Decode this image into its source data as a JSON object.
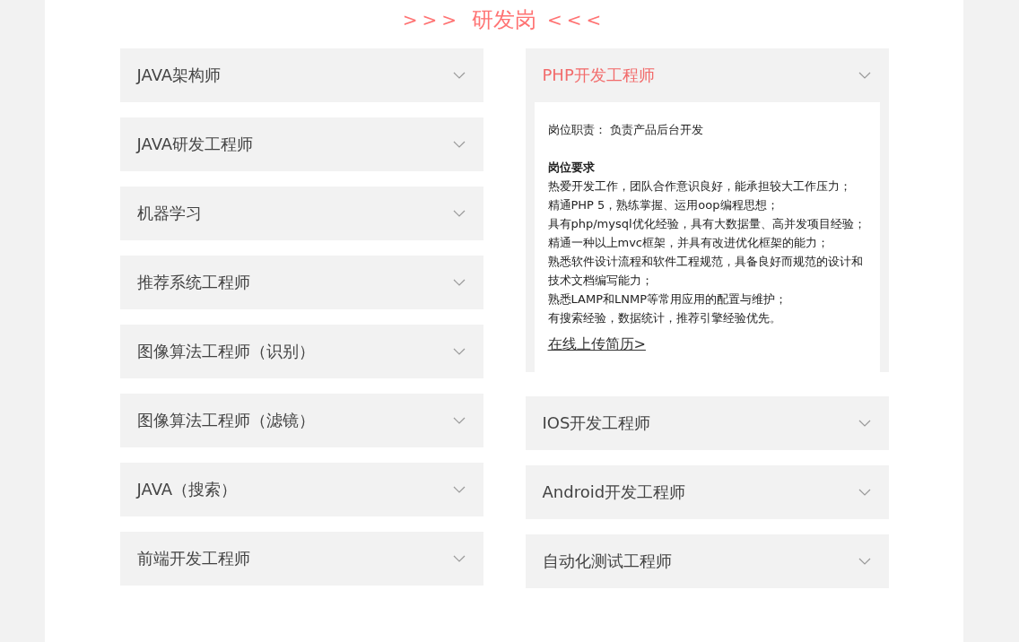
{
  "section_title": {
    "left_mark": ">>>",
    "text": "研发岗",
    "right_mark": "<<<"
  },
  "columns": [
    {
      "items": [
        {
          "title": "JAVA架构师",
          "expanded": false
        },
        {
          "title": "JAVA研发工程师",
          "expanded": false
        },
        {
          "title": "机器学习",
          "expanded": false
        },
        {
          "title": "推荐系统工程师",
          "expanded": false
        },
        {
          "title": "图像算法工程师（识别）",
          "expanded": false
        },
        {
          "title": "图像算法工程师（滤镜）",
          "expanded": false
        },
        {
          "title": "JAVA（搜索）",
          "expanded": false
        },
        {
          "title": "前端开发工程师",
          "expanded": false
        }
      ]
    },
    {
      "items": [
        {
          "title": "PHP开发工程师",
          "expanded": true,
          "details": {
            "duty": "岗位职责： 负责产品后台开发",
            "requirements_heading": "岗位要求",
            "requirements": [
              "热爱开发工作，团队合作意识良好，能承担较大工作压力；",
              "精通PHP 5，熟练掌握、运用oop编程思想；",
              "具有php/mysql优化经验，具有大数据量、高并发项目经验；",
              "精通一种以上mvc框架，并具有改进优化框架的能力；",
              "熟悉软件设计流程和软件工程规范，具备良好而规范的设计和技术文档编写能力；",
              "熟悉LAMP和LNMP等常用应用的配置与维护；",
              "有搜索经验，数据统计，推荐引擎经验优先。"
            ],
            "apply_link": "在线上传简历>"
          }
        },
        {
          "title": "IOS开发工程师",
          "expanded": false
        },
        {
          "title": "Android开发工程师",
          "expanded": false
        },
        {
          "title": "自动化测试工程师",
          "expanded": false
        }
      ]
    }
  ]
}
